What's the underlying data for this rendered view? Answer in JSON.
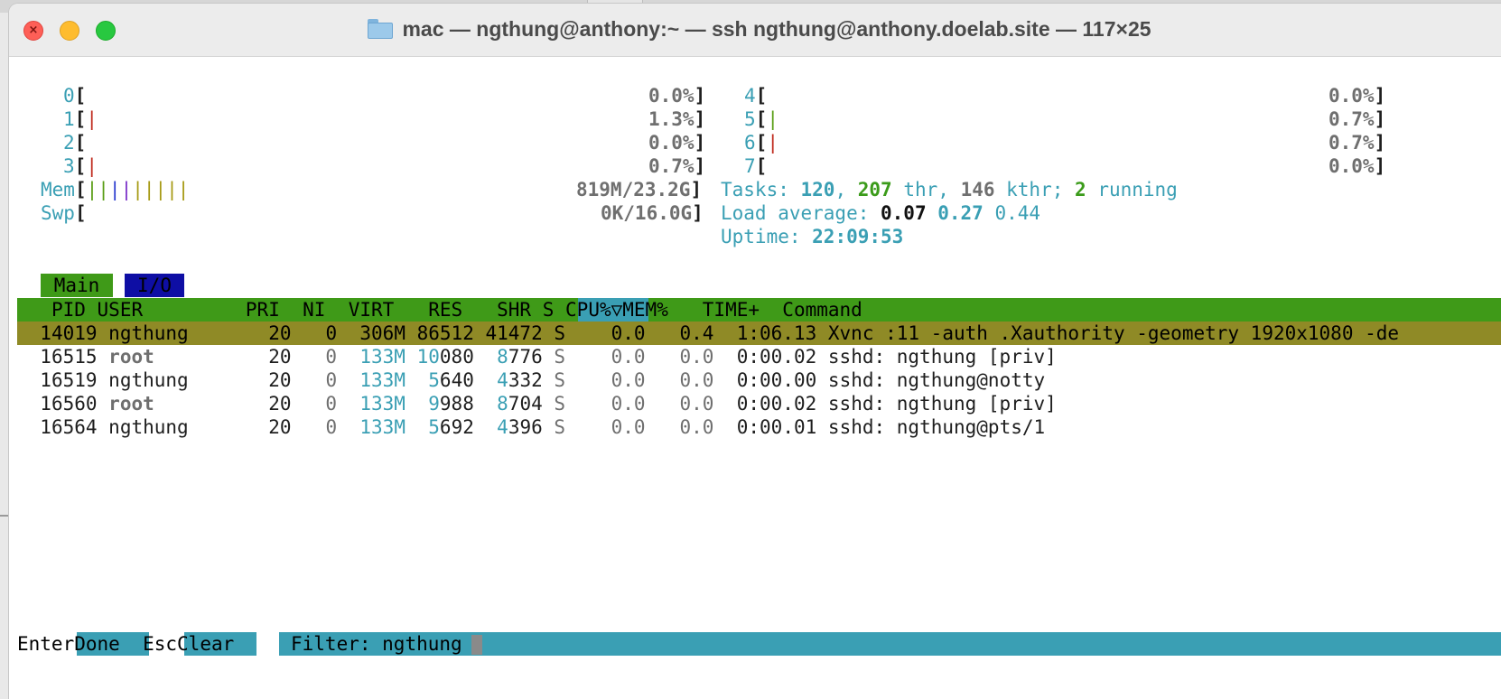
{
  "window": {
    "title": "mac — ngthung@anthony:~ — ssh ngthung@anthony.doelab.site — 117×25"
  },
  "cpus": [
    {
      "id": "0",
      "bar": "",
      "bar_color": "",
      "value": "0.0%"
    },
    {
      "id": "1",
      "bar": "|",
      "bar_color": "#c02b1e",
      "value": "1.3%"
    },
    {
      "id": "2",
      "bar": "",
      "bar_color": "",
      "value": "0.0%"
    },
    {
      "id": "3",
      "bar": "|",
      "bar_color": "#c02b1e",
      "value": "0.7%"
    },
    {
      "id": "4",
      "bar": "",
      "bar_color": "",
      "value": "0.0%"
    },
    {
      "id": "5",
      "bar": "|",
      "bar_color": "#5a9e16",
      "value": "0.7%"
    },
    {
      "id": "6",
      "bar": "|",
      "bar_color": "#c02b1e",
      "value": "0.7%"
    },
    {
      "id": "7",
      "bar": "",
      "bar_color": "",
      "value": "0.0%"
    }
  ],
  "mem": {
    "label": "Mem",
    "bar_segments": [
      {
        "text": "|",
        "color": "#5a9e16"
      },
      {
        "text": "|",
        "color": "#5a9e16"
      },
      {
        "text": "|",
        "color": "#2b3ccf"
      },
      {
        "text": "|",
        "color": "#7a2fc8"
      },
      {
        "text": "|||||",
        "color": "#a69a14"
      }
    ],
    "value": "819M/23.2G"
  },
  "swp": {
    "label": "Swp",
    "value": "0K/16.0G"
  },
  "tasks": {
    "label": "Tasks: ",
    "count": "120",
    "sep1": ", ",
    "threads": "207",
    "thr_label": " thr",
    "sep2": ", ",
    "kthreads": "146",
    "kthr_label": " kthr",
    "sep3": "; ",
    "running": "2",
    "running_label": " running"
  },
  "load": {
    "label": "Load average: ",
    "l1": "0.07",
    "l5": "0.27",
    "l15": "0.44"
  },
  "uptime": {
    "label": "Uptime: ",
    "value": "22:09:53"
  },
  "tabs": {
    "main": "Main",
    "io": "I/O"
  },
  "columns": {
    "pid": "PID",
    "user": "USER",
    "pri": "PRI",
    "ni": "NI",
    "virt": "VIRT",
    "res": "RES",
    "shr": "SHR",
    "s": "S",
    "cpu": "CPU%",
    "sort_indicator": "▽",
    "mem": "MEM%",
    "time": "TIME+",
    "command": "Command"
  },
  "processes": [
    {
      "pid": "14019",
      "user": "ngthung",
      "pri": "20",
      "ni": "0",
      "virt": "306M",
      "res_hi": "",
      "res_lo": "86512",
      "shr_hi": "",
      "shr_lo": "41472",
      "s": "S",
      "cpu": "0.0",
      "mem": "0.4",
      "time": "1:06.13",
      "command": "Xvnc :11 -auth .Xauthority -geometry 1920x1080 -de",
      "selected": true
    },
    {
      "pid": "16515",
      "user": "root",
      "pri": "20",
      "ni": "0",
      "virt": "133M",
      "res_hi": "10",
      "res_lo": "080",
      "shr_hi": "8",
      "shr_lo": "776",
      "s": "S",
      "cpu": "0.0",
      "mem": "0.0",
      "time": "0:00.02",
      "command": "sshd: ngthung [priv]",
      "selected": false
    },
    {
      "pid": "16519",
      "user": "ngthung",
      "pri": "20",
      "ni": "0",
      "virt": "133M",
      "res_hi": "5",
      "res_lo": "640",
      "shr_hi": "4",
      "shr_lo": "332",
      "s": "S",
      "cpu": "0.0",
      "mem": "0.0",
      "time": "0:00.00",
      "command": "sshd: ngthung@notty",
      "selected": false
    },
    {
      "pid": "16560",
      "user": "root",
      "pri": "20",
      "ni": "0",
      "virt": "133M",
      "res_hi": "9",
      "res_lo": "988",
      "shr_hi": "8",
      "shr_lo": "704",
      "s": "S",
      "cpu": "0.0",
      "mem": "0.0",
      "time": "0:00.02",
      "command": "sshd: ngthung [priv]",
      "selected": false
    },
    {
      "pid": "16564",
      "user": "ngthung",
      "pri": "20",
      "ni": "0",
      "virt": "133M",
      "res_hi": "5",
      "res_lo": "692",
      "shr_hi": "4",
      "shr_lo": "396",
      "s": "S",
      "cpu": "0.0",
      "mem": "0.0",
      "time": "0:00.01",
      "command": "sshd: ngthung@pts/1",
      "selected": false
    }
  ],
  "footer": {
    "enter_key": "Enter",
    "enter_label": "Done",
    "esc_key": "Esc",
    "esc_label": "Clear",
    "filter_label": "Filter: ",
    "filter_value": "ngthung"
  }
}
